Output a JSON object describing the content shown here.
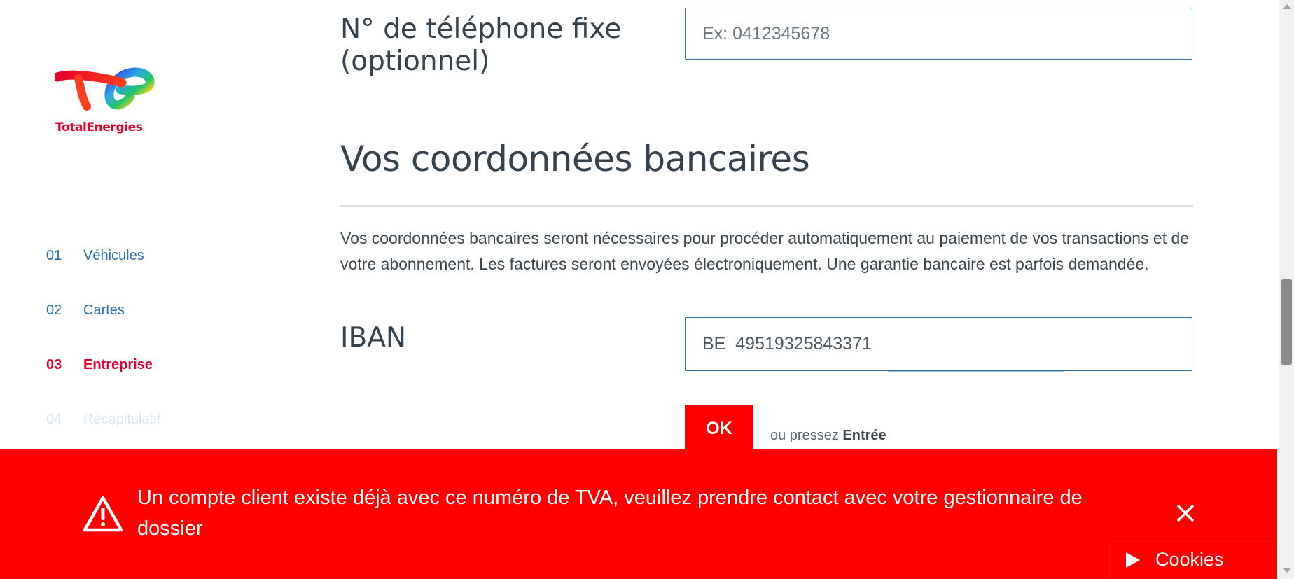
{
  "brand": {
    "name": "TotalEnergies",
    "color": "#e4002b"
  },
  "sidebar": {
    "steps": [
      {
        "num": "01",
        "label": "Véhicules",
        "state": "done"
      },
      {
        "num": "02",
        "label": "Cartes",
        "state": "done"
      },
      {
        "num": "03",
        "label": "Entreprise",
        "state": "active"
      },
      {
        "num": "04",
        "label": "Récapitulatif",
        "state": "todo"
      }
    ]
  },
  "phone": {
    "label": "N° de téléphone fixe (optionnel)",
    "placeholder": "Ex: 0412345678",
    "value": ""
  },
  "bank": {
    "title": "Vos coordonnées bancaires",
    "description": "Vos coordonnées bancaires seront nécessaires pour procéder automatiquement au paiement de vos transactions et de votre abonnement. Les factures seront envoyées électroniquement. Une garantie bancaire est parfois demandée.",
    "iban_label": "IBAN",
    "iban_value": "BE  49519325843371"
  },
  "submit": {
    "label": "OK",
    "hint_prefix": "ou pressez",
    "hint_key": "Entrée"
  },
  "alert": {
    "icon": "warning-icon",
    "message": "Un compte client existe déjà avec ce numéro de TVA, veuillez prendre contact avec votre gestionnaire de dossier",
    "background": "#ff0000"
  },
  "cookies": {
    "label": "Cookies",
    "icon": "play-icon"
  }
}
